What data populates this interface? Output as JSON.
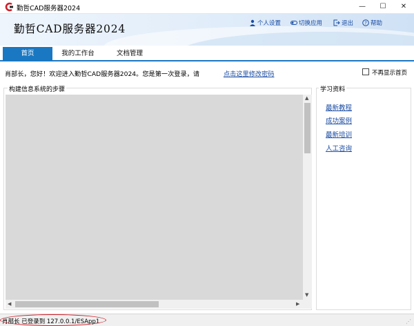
{
  "window": {
    "title": "勤哲CAD服务器2024",
    "min_glyph": "—",
    "max_glyph": "☐",
    "close_glyph": "✕"
  },
  "header": {
    "brand": "勤哲CAD服务器2024",
    "links": {
      "profile": "个人设置",
      "switch": "切换应用",
      "exit": "退出",
      "help": "帮助"
    }
  },
  "tabs": [
    {
      "label": "首页",
      "active": true
    },
    {
      "label": "我的工作台",
      "active": false
    },
    {
      "label": "文档管理",
      "active": false
    }
  ],
  "welcome": {
    "message": "肖部长，您好！欢迎进入勤哲CAD服务器2024。您是第一次登录，请",
    "link": "点击这里修改密码",
    "checkbox_label": "不再显示首页",
    "checkbox_checked": false
  },
  "main_panel": {
    "title": "构建信息系统的步骤"
  },
  "learning": {
    "title": "学习资料",
    "links": [
      "最新教程",
      "成功案例",
      "最新培训",
      "人工咨询"
    ]
  },
  "status": {
    "text": "肖部长 已登录到 127.0.0.1/ESApp1"
  },
  "colors": {
    "tab_active": "#1a78c2",
    "link": "#1b4da3",
    "highlight_ellipse": "#d0202a",
    "content_bg": "#d9d9d9"
  }
}
